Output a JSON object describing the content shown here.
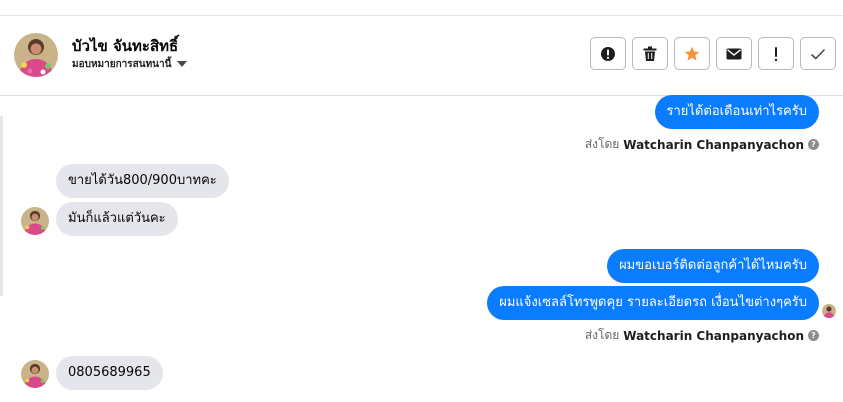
{
  "header": {
    "contact_name": "บัวไข จันทะสิทธิ์",
    "assign_label": "มอบหมายการสนทนานี้",
    "actions": [
      {
        "name": "spam-button",
        "icon": "alert-circle-icon"
      },
      {
        "name": "delete-button",
        "icon": "trash-icon"
      },
      {
        "name": "star-button",
        "icon": "star-icon"
      },
      {
        "name": "mark-unread-button",
        "icon": "envelope-icon"
      },
      {
        "name": "follow-up-button",
        "icon": "exclamation-icon"
      },
      {
        "name": "mark-done-button",
        "icon": "check-icon"
      }
    ]
  },
  "messages": [
    {
      "direction": "outgoing",
      "text": "รายได้ต่อเดือนเท่าไรครับ"
    },
    {
      "direction": "incoming",
      "text": "ขายได้วัน800/900บาทคะ"
    },
    {
      "direction": "incoming",
      "text": "มันก็แล้วแต่วันคะ"
    },
    {
      "direction": "outgoing",
      "text": "ผมขอเบอร์ติดต่อลูกค้าได้ไหมครับ"
    },
    {
      "direction": "outgoing",
      "text": "ผมแจ้งเซลล์โทรพูดคุย รายละเอียดรถ เงื่อนไขต่างๆครับ"
    },
    {
      "direction": "incoming",
      "text": "0805689965"
    }
  ],
  "sent_by": {
    "prefix": "ส่งโดย",
    "name": "Watcharin Chanpanyachon"
  },
  "colors": {
    "outgoing_bubble": "#0a7cff",
    "incoming_bubble": "#e4e6eb",
    "star": "#f7923b"
  }
}
